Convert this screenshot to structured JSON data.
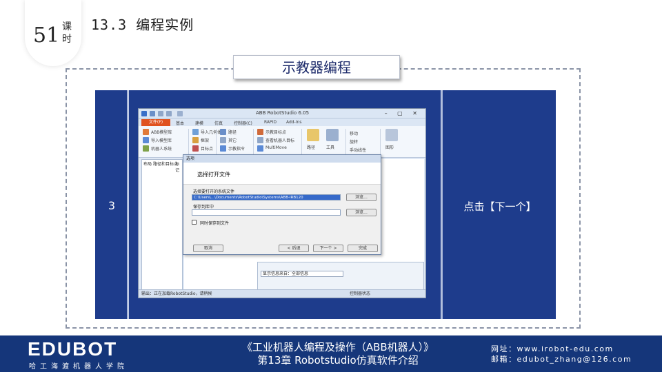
{
  "lesson": {
    "number": "51",
    "unit": "课时"
  },
  "section_title": "13.3 编程实例",
  "panel_title": "示教器编程",
  "step": {
    "number": "3",
    "description": "点击【下一个】"
  },
  "screenshot": {
    "window_title": "ABB RobotStudio 6.05",
    "file_tab": "文件(F)",
    "tabs": [
      "基本",
      "建模",
      "仿真",
      "控制器(C)",
      "RAPID",
      "Add-Ins"
    ],
    "ribbon": {
      "g1": [
        "ABB模型库",
        "导入模型库",
        "机器人系统"
      ],
      "g2": [
        "导入几何体",
        "框架",
        "目标点"
      ],
      "g3": [
        "路径",
        "其它",
        "示教指令"
      ],
      "g4": [
        "示教目标点",
        "查看机器人目标",
        "MultiMove"
      ],
      "big": [
        "路径",
        "工具"
      ],
      "g5": [
        "移动",
        "旋转",
        "手动线性"
      ],
      "g6": [
        "图形"
      ]
    },
    "left_pane_tabs": [
      "布局",
      "路径和目标点",
      "标记"
    ],
    "dialog": {
      "caption": "选项",
      "heading": "选择打开文件",
      "label_file": "选择要打开的系统文件",
      "file_value": "C:\\Users\\...\\Documents\\RobotStudio\\Systems\\ABB-IRB120",
      "browse": "浏览...",
      "label_save": "保存到库中",
      "save_value": "",
      "check_label": "同时保存到文件",
      "cancel": "取消",
      "back": "< 后退",
      "next": "下一个 >",
      "finish": "完成"
    },
    "bottom_panel_combo": "显示信息来自：全部信息",
    "status_text": "输出：正在加载RobotStudio，请稍候",
    "status_right": "控制器状态"
  },
  "footer": {
    "logo": "EDUBOT",
    "logo_sub": "哈工海渡机器人学院",
    "book_title": "《工业机器人编程及操作（ABB机器人）》",
    "chapter": "第13章 Robotstudio仿真软件介绍",
    "website": "网址：www.irobot-edu.com",
    "email": "邮箱：edubot_zhang@126.com"
  },
  "colors": {
    "navy": "#1e3c8c",
    "footer": "#15367a",
    "file_tab": "#e0521f"
  }
}
